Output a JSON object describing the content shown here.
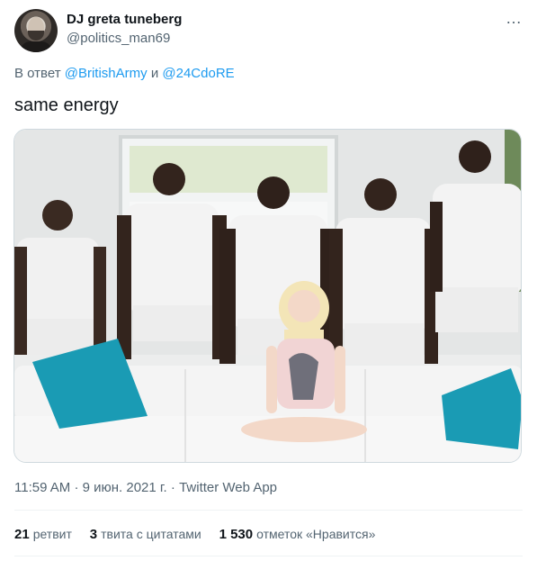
{
  "author": {
    "display_name": "DJ greta tuneberg",
    "handle": "@politics_man69"
  },
  "more_icon": "…",
  "reply": {
    "prefix": "В ответ",
    "mention1": "@BritishArmy",
    "conjunction": "и",
    "mention2": "@24CdoRE"
  },
  "tweet": {
    "text": "same energy"
  },
  "meta": {
    "time": "11:59 AM",
    "separator1": "·",
    "date": "9 июн. 2021 г.",
    "separator2": "·",
    "source": "Twitter Web App"
  },
  "stats": {
    "retweets_count": "21",
    "retweets_label": "ретвит",
    "quotes_count": "3",
    "quotes_label": "твита с цитатами",
    "likes_count": "1 530",
    "likes_label": "отметок «Нравится»"
  },
  "colors": {
    "link": "#1d9bf0",
    "secondary_text": "#536471",
    "primary_text": "#0f1419",
    "accent_pillow": "#1a9bb4"
  }
}
